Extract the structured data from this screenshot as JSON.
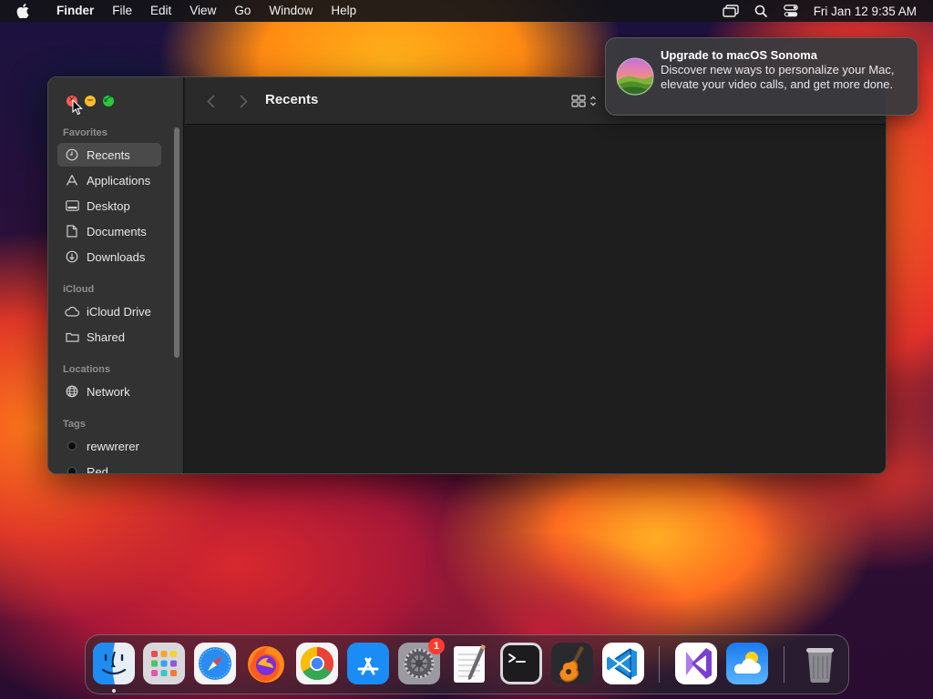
{
  "menubar": {
    "apple_icon": "apple-icon",
    "app_name": "Finder",
    "menus": [
      "File",
      "Edit",
      "View",
      "Go",
      "Window",
      "Help"
    ],
    "status_icons": [
      "screen-mirroring-icon",
      "spotlight-search-icon",
      "control-center-icon"
    ],
    "clock": "Fri Jan 12  9:35 AM"
  },
  "finder": {
    "title": "Recents",
    "sidebar": {
      "favorites_title": "Favorites",
      "favorites": [
        {
          "label": "Recents",
          "icon": "clock-icon",
          "selected": true
        },
        {
          "label": "Applications",
          "icon": "applications-icon"
        },
        {
          "label": "Desktop",
          "icon": "desktop-icon"
        },
        {
          "label": "Documents",
          "icon": "document-icon"
        },
        {
          "label": "Downloads",
          "icon": "download-icon"
        }
      ],
      "icloud_title": "iCloud",
      "icloud": [
        {
          "label": "iCloud Drive",
          "icon": "cloud-icon"
        },
        {
          "label": "Shared",
          "icon": "shared-folder-icon"
        }
      ],
      "locations_title": "Locations",
      "locations": [
        {
          "label": "Network",
          "icon": "globe-icon"
        }
      ],
      "tags_title": "Tags",
      "tags": [
        {
          "label": "rewwrerer",
          "color": "#0c0c0c"
        },
        {
          "label": "Red",
          "color": "#0c0c0c"
        }
      ]
    }
  },
  "notification": {
    "title": "Upgrade to macOS Sonoma",
    "body": "Discover new ways to personalize your Mac, elevate your video calls, and get more done."
  },
  "dock": {
    "apps": [
      "Finder",
      "Launchpad",
      "Safari",
      "Firefox",
      "Chrome",
      "App Store",
      "System Settings",
      "TextEdit",
      "Terminal",
      "GarageBand",
      "Visual Studio Code",
      "Visual Studio",
      "Weather",
      "Trash"
    ],
    "settings_badge": "1"
  }
}
